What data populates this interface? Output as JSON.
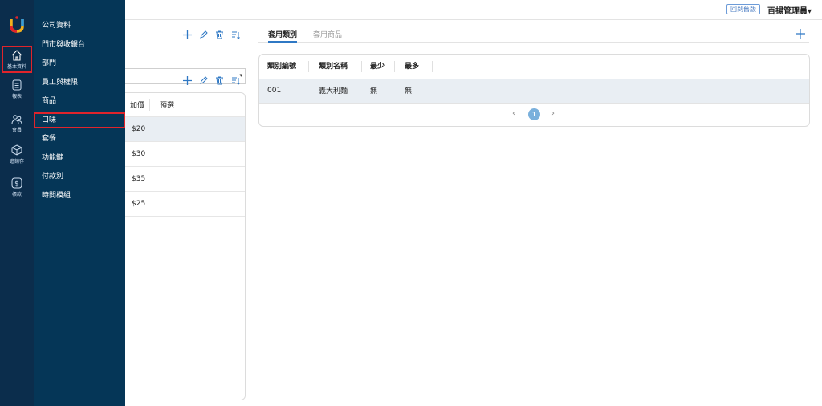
{
  "topbar": {
    "back_old_label": "回到舊版",
    "user_label": "百揚管理員▾"
  },
  "rail": {
    "items": [
      {
        "label": "基本資料",
        "icon": "home-icon"
      },
      {
        "label": "報表",
        "icon": "report-icon"
      },
      {
        "label": "會員",
        "icon": "member-icon"
      },
      {
        "label": "進銷存",
        "icon": "inventory-icon"
      },
      {
        "label": "帳款",
        "icon": "dollar-icon"
      }
    ]
  },
  "submenu": {
    "items": [
      "公司資料",
      "門市與收銀台",
      "部門",
      "員工與權限",
      "商品",
      "口味",
      "套餐",
      "功能鍵",
      "付款別",
      "時間模組"
    ]
  },
  "left": {
    "table_headers": [
      "加價",
      "預選"
    ],
    "rows": [
      "$20",
      "$30",
      "$35",
      "$25"
    ]
  },
  "right": {
    "tabs": [
      "套用類別",
      "套用商品"
    ],
    "table_headers": [
      "類別編號",
      "類別名稱",
      "最少",
      "最多"
    ],
    "rows": [
      {
        "code": "001",
        "name": "義大利麵",
        "min": "無",
        "max": "無"
      }
    ],
    "pager": {
      "prev": "‹",
      "page": "1",
      "next": "›"
    }
  },
  "colors": {
    "accent": "#2f78c4",
    "highlight": "#e0242b",
    "sidebar": "#053657"
  }
}
